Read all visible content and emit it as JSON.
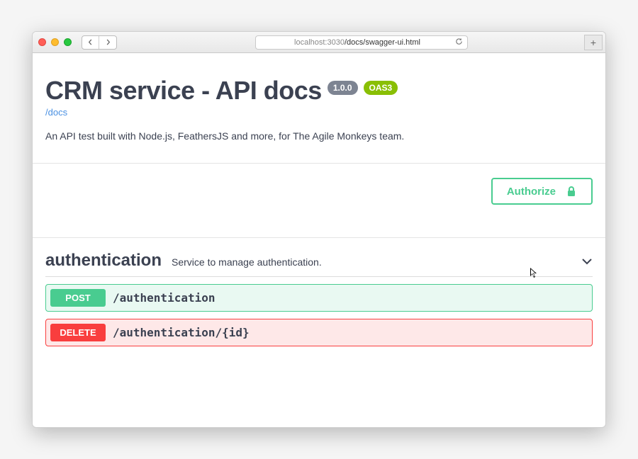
{
  "browser": {
    "url_host": "localhost:3030",
    "url_path": "/docs/swagger-ui.html"
  },
  "header": {
    "title": "CRM service - API docs",
    "version_badge": "1.0.0",
    "oas_badge": "OAS3",
    "docs_link": "/docs",
    "description": "An API test built with Node.js, FeathersJS and more, for The Agile Monkeys team."
  },
  "authorize": {
    "label": "Authorize"
  },
  "tag": {
    "name": "authentication",
    "description": "Service to manage authentication."
  },
  "operations": [
    {
      "method": "POST",
      "path": "/authentication",
      "kind": "post"
    },
    {
      "method": "DELETE",
      "path": "/authentication/{id}",
      "kind": "delete"
    }
  ],
  "colors": {
    "post": "#49cc90",
    "delete": "#f93e3e",
    "oas": "#89bf04",
    "version": "#7d8492"
  }
}
